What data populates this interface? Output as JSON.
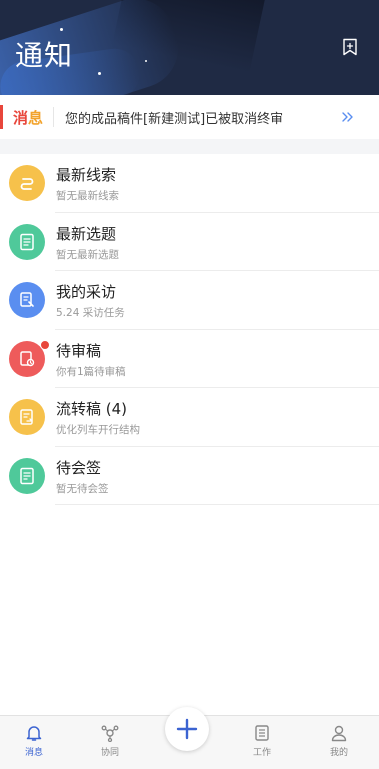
{
  "header": {
    "title": "通知"
  },
  "banner": {
    "badge_part1": "消",
    "badge_part2": "息",
    "text": "您的成品稿件[新建测试]已被取消终审"
  },
  "items": [
    {
      "label": "最新线索",
      "sub": "暂无最新线索",
      "color": "#f6c14b",
      "icon": "link-icon"
    },
    {
      "label": "最新选题",
      "sub": "暂无最新选题",
      "color": "#4fc99a",
      "icon": "document-icon"
    },
    {
      "label": "我的采访",
      "sub": "5.24 采访任务",
      "color": "#5a8ef0",
      "icon": "interview-icon"
    },
    {
      "label": "待审稿",
      "sub": "你有1篇待审稿",
      "color": "#ee5b5b",
      "icon": "review-icon",
      "has_dot": true
    },
    {
      "label": "流转稿 (4)",
      "sub": "优化列车开行结构",
      "color": "#f6c14b",
      "icon": "transfer-icon"
    },
    {
      "label": "待会签",
      "sub": "暂无待会签",
      "color": "#4fc99a",
      "icon": "sign-icon"
    }
  ],
  "tabs": [
    {
      "label": "消息",
      "icon": "bell-icon",
      "active": true
    },
    {
      "label": "协同",
      "icon": "collaborate-icon"
    },
    {
      "label": "工作",
      "icon": "work-icon"
    },
    {
      "label": "我的",
      "icon": "user-icon"
    }
  ],
  "colors": {
    "accent": "#3b63d1",
    "header_bg": "#1f2a44",
    "alert": "#e8463b"
  }
}
